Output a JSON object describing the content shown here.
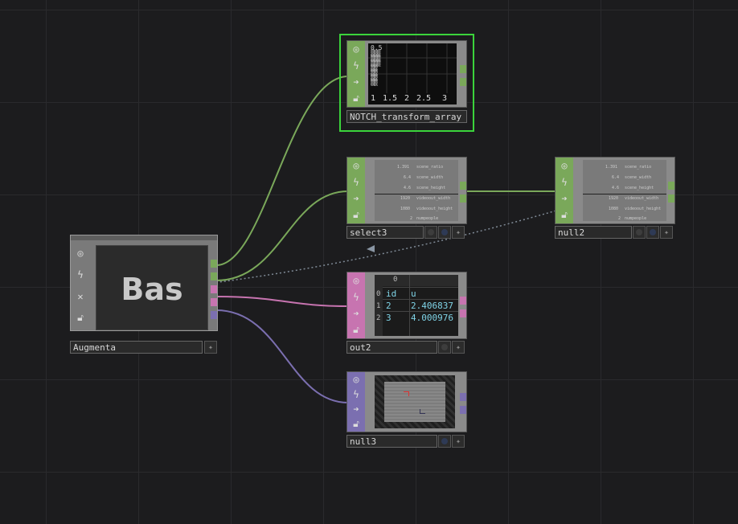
{
  "colors": {
    "background": "#1c1c1e",
    "chop_green": "#7aa85a",
    "dat_pink": "#c774b0",
    "top_purple": "#7b6fb0",
    "comp_gray": "#8a8a8a",
    "selected_outline": "#3bd43b",
    "dat_text": "#7fd3e6"
  },
  "icons": [
    "viewer-toggle-icon",
    "cook-flag-icon",
    "bypass-icon",
    "lock-icon",
    "gear-icon"
  ],
  "nodes": {
    "augmenta": {
      "name": "Augmenta",
      "preview_text": "Bas"
    },
    "notch": {
      "name": "NOTCH_transform_array",
      "values_text": "0.5",
      "x_ticks": [
        "1",
        "1.5",
        "2",
        "2.5",
        "3"
      ]
    },
    "select3": {
      "name": "select3",
      "channels": [
        {
          "value": "1.391",
          "name": "scene_ratio"
        },
        {
          "value": "6.4",
          "name": "scene_width"
        },
        {
          "value": "4.6",
          "name": "scene_height"
        },
        {
          "value": "1920",
          "name": "videoout_width"
        },
        {
          "value": "1080",
          "name": "videoout_height"
        },
        {
          "value": "2",
          "name": "numpeople"
        }
      ]
    },
    "null2": {
      "name": "null2",
      "channels": [
        {
          "value": "1.391",
          "name": "scene_ratio"
        },
        {
          "value": "6.4",
          "name": "scene_width"
        },
        {
          "value": "4.6",
          "name": "scene_height"
        },
        {
          "value": "1920",
          "name": "videoout_width"
        },
        {
          "value": "1080",
          "name": "videoout_height"
        },
        {
          "value": "2",
          "name": "numpeople"
        }
      ]
    },
    "out2": {
      "name": "out2",
      "col_header": "0",
      "rows": [
        {
          "index": "0",
          "c0": "id",
          "c1": "u"
        },
        {
          "index": "1",
          "c0": "2",
          "c1": "2.406837"
        },
        {
          "index": "2",
          "c0": "3",
          "c1": "4.000976"
        }
      ]
    },
    "null3": {
      "name": "null3"
    }
  }
}
